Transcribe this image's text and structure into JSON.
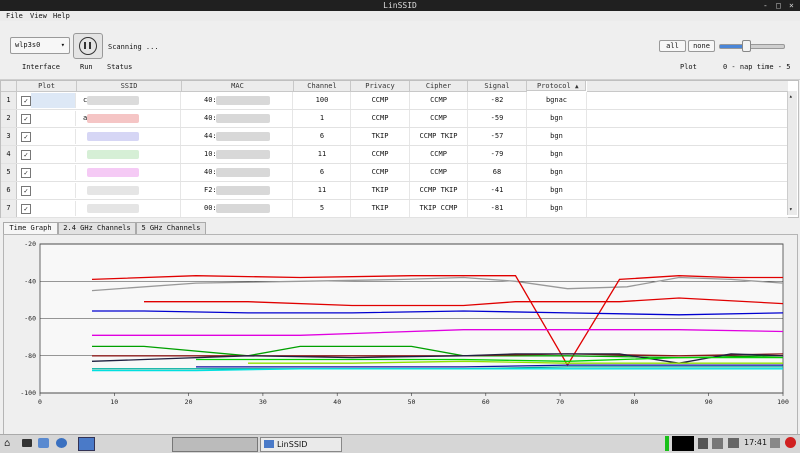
{
  "window": {
    "title": "LinSSID",
    "controls": [
      "-",
      "□",
      "×"
    ]
  },
  "menu": [
    "File",
    "View",
    "Help"
  ],
  "toolbar": {
    "interface_value": "wlp3s0",
    "interface_label": "Interface",
    "run_label": "Run",
    "status_label": "Status",
    "status_text": "Scanning ...",
    "all_label": "all",
    "none_label": "none",
    "slider_value": 0.4,
    "plot_label": "Plot",
    "naptime_text": "0 - nap time - 5"
  },
  "table": {
    "columns": [
      "Plot",
      "SSID",
      "MAC",
      "Channel",
      "Privacy",
      "Cipher",
      "Signal",
      "Protocol"
    ],
    "rows": [
      {
        "num": "1",
        "plot": "✓",
        "mac": "40:",
        "channel": "100",
        "privacy": "CCMP",
        "cipher": "CCMP",
        "signal": "-82",
        "protocol": "bgnac",
        "ssid_prefix": "c",
        "ssid_color": "#cfcfcf"
      },
      {
        "num": "2",
        "plot": "✓",
        "mac": "40:",
        "channel": "1",
        "privacy": "CCMP",
        "cipher": "CCMP",
        "signal": "-59",
        "protocol": "bgn",
        "ssid_prefix": "a",
        "ssid_color": "#f2b2b2"
      },
      {
        "num": "3",
        "plot": "✓",
        "mac": "44:",
        "channel": "6",
        "privacy": "TKIP",
        "cipher": "CCMP TKIP",
        "signal": "-57",
        "protocol": "bgn",
        "ssid_prefix": "",
        "ssid_color": "#c8c8f2"
      },
      {
        "num": "4",
        "plot": "✓",
        "mac": "10:",
        "channel": "11",
        "privacy": "CCMP",
        "cipher": "CCMP",
        "signal": "-79",
        "protocol": "bgn",
        "ssid_prefix": "",
        "ssid_color": "#c8eac8"
      },
      {
        "num": "5",
        "plot": "✓",
        "mac": "40:",
        "channel": "6",
        "privacy": "CCMP",
        "cipher": "CCMP",
        "signal": "68",
        "protocol": "bgn",
        "ssid_prefix": "",
        "ssid_color": "#f2b8f2"
      },
      {
        "num": "6",
        "plot": "✓",
        "mac": "F2:",
        "channel": "11",
        "privacy": "TKIP",
        "cipher": "CCMP TKIP",
        "signal": "-41",
        "protocol": "bgn",
        "ssid_prefix": "",
        "ssid_color": "#dcdcdc"
      },
      {
        "num": "7",
        "plot": "✓",
        "mac": "00:",
        "channel": "5",
        "privacy": "TKIP",
        "cipher": "TKIP CCMP",
        "signal": "-81",
        "protocol": "bgn",
        "ssid_prefix": "",
        "ssid_color": "#dcdcdc"
      }
    ]
  },
  "tabs": [
    "Time Graph",
    "2.4 GHz Channels",
    "5 GHz Channels"
  ],
  "active_tab": 0,
  "chart_data": {
    "type": "line",
    "title": "",
    "xlabel": "",
    "ylabel": "",
    "xlim": [
      0,
      100
    ],
    "ylim": [
      -100,
      -20
    ],
    "xticks": [
      0,
      10,
      20,
      30,
      40,
      50,
      60,
      70,
      80,
      90,
      100
    ],
    "yticks": [
      -20,
      -40,
      -60,
      -80,
      -100
    ],
    "grid": true,
    "series": [
      {
        "color": "#999999",
        "x": [
          7,
          21,
          35,
          49,
          57,
          64,
          71,
          79,
          86,
          93,
          100
        ],
        "y": [
          -45,
          -41,
          -40,
          -39,
          -38,
          -40,
          -44,
          -43,
          -38,
          -39,
          -41
        ]
      },
      {
        "color": "#e00000",
        "x": [
          7,
          21,
          35,
          50,
          64,
          71,
          78,
          86,
          93,
          100
        ],
        "y": [
          -39,
          -37,
          -38,
          -37,
          -37,
          -85,
          -39,
          -37,
          -38,
          -38
        ]
      },
      {
        "color": "#e00000",
        "x": [
          14,
          28,
          42,
          57,
          64,
          71,
          78,
          86,
          100
        ],
        "y": [
          -51,
          -51,
          -53,
          -53,
          -51,
          -51,
          -51,
          -49,
          -52
        ]
      },
      {
        "color": "#0000d0",
        "x": [
          7,
          14,
          28,
          42,
          57,
          71,
          86,
          100
        ],
        "y": [
          -56,
          -56,
          -57,
          -57,
          -56,
          -57,
          -58,
          -57
        ]
      },
      {
        "color": "#e000e0",
        "x": [
          7,
          21,
          35,
          57,
          71,
          86,
          100
        ],
        "y": [
          -69,
          -69,
          -69,
          -66,
          -66,
          -66,
          -67
        ]
      },
      {
        "color": "#00a000",
        "x": [
          7,
          14,
          28,
          35,
          50,
          57,
          71,
          86,
          100
        ],
        "y": [
          -75,
          -75,
          -80,
          -75,
          -75,
          -80,
          -80,
          -81,
          -80
        ]
      },
      {
        "color": "#8b1a1a",
        "x": [
          7,
          21,
          35,
          57,
          71,
          86,
          100
        ],
        "y": [
          -80,
          -80,
          -80,
          -80,
          -79,
          -80,
          -79
        ]
      },
      {
        "color": "#202040",
        "x": [
          7,
          14,
          28,
          42,
          57,
          64,
          71,
          78,
          86,
          93,
          100
        ],
        "y": [
          -83,
          -82,
          -80,
          -81,
          -80,
          -79,
          -79,
          -79,
          -84,
          -79,
          -80
        ]
      },
      {
        "color": "#00d000",
        "x": [
          21,
          35,
          57,
          71,
          86,
          100
        ],
        "y": [
          -82,
          -82,
          -82,
          -83,
          -81,
          -81
        ]
      },
      {
        "color": "#90e000",
        "x": [
          28,
          42,
          57,
          71,
          86,
          100
        ],
        "y": [
          -84,
          -84,
          -83,
          -84,
          -84,
          -84
        ]
      },
      {
        "color": "#00b0a0",
        "x": [
          7,
          21,
          35,
          57,
          71,
          86,
          100
        ],
        "y": [
          -87,
          -87,
          -87,
          -87,
          -86,
          -86,
          -86
        ]
      },
      {
        "color": "#00e0e0",
        "x": [
          7,
          21,
          35,
          57,
          71,
          86,
          100
        ],
        "y": [
          -88,
          -88,
          -87,
          -87,
          -87,
          -87,
          -87
        ]
      },
      {
        "color": "#1010a0",
        "x": [
          21,
          35,
          57,
          71,
          86,
          100
        ],
        "y": [
          -86,
          -86,
          -86,
          -85,
          -85,
          -85
        ]
      }
    ]
  },
  "taskbar": {
    "window_label": "LinSSID",
    "clock": "17:41"
  }
}
